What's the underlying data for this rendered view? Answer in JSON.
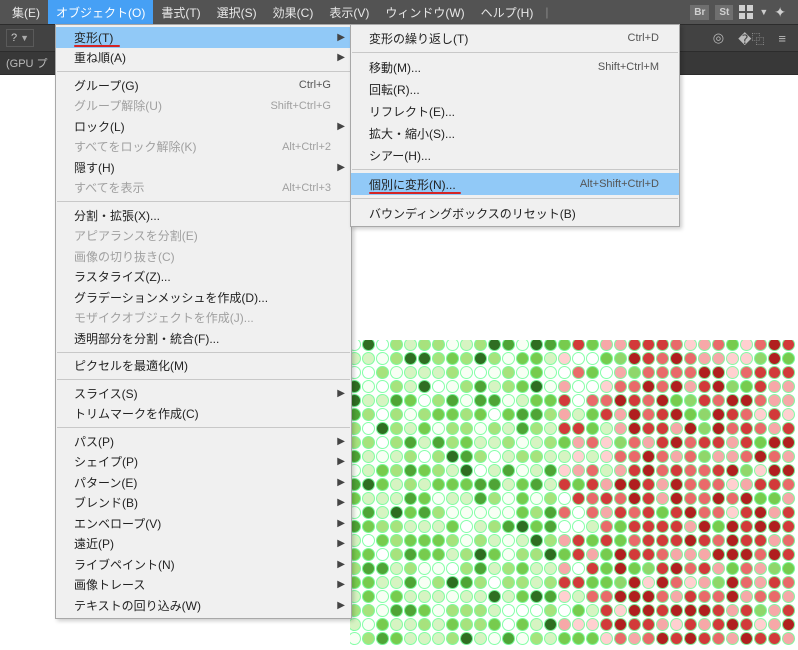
{
  "menubar": {
    "items": [
      "集(E)",
      "オブジェクト(O)",
      "書式(T)",
      "選択(S)",
      "効果(C)",
      "表示(V)",
      "ウィンドウ(W)",
      "ヘルプ(H)"
    ],
    "active_index": 1,
    "badges": [
      "Br",
      "St"
    ]
  },
  "toolbar2": {
    "left_glyph": "?",
    "right_tools": [
      "target-icon",
      "crop-icon",
      "equals-icon"
    ]
  },
  "bar3": {
    "label": "(GPU プ"
  },
  "dropdown1": {
    "groups": [
      [
        {
          "label": "変形(T)",
          "submenu": true,
          "highlight": true,
          "underline": true
        },
        {
          "label": "重ね順(A)",
          "submenu": true
        }
      ],
      [
        {
          "label": "グループ(G)",
          "shortcut": "Ctrl+G"
        },
        {
          "label": "グループ解除(U)",
          "shortcut": "Shift+Ctrl+G",
          "disabled": true
        },
        {
          "label": "ロック(L)",
          "submenu": true
        },
        {
          "label": "すべてをロック解除(K)",
          "shortcut": "Alt+Ctrl+2",
          "disabled": true
        },
        {
          "label": "隠す(H)",
          "submenu": true
        },
        {
          "label": "すべてを表示",
          "shortcut": "Alt+Ctrl+3",
          "disabled": true
        }
      ],
      [
        {
          "label": "分割・拡張(X)..."
        },
        {
          "label": "アピアランスを分割(E)",
          "disabled": true
        },
        {
          "label": "画像の切り抜き(C)",
          "disabled": true
        },
        {
          "label": "ラスタライズ(Z)..."
        },
        {
          "label": "グラデーションメッシュを作成(D)..."
        },
        {
          "label": "モザイクオブジェクトを作成(J)...",
          "disabled": true
        },
        {
          "label": "透明部分を分割・統合(F)..."
        }
      ],
      [
        {
          "label": "ピクセルを最適化(M)"
        }
      ],
      [
        {
          "label": "スライス(S)",
          "submenu": true
        },
        {
          "label": "トリムマークを作成(C)"
        }
      ],
      [
        {
          "label": "パス(P)",
          "submenu": true
        },
        {
          "label": "シェイプ(P)",
          "submenu": true
        },
        {
          "label": "パターン(E)",
          "submenu": true
        },
        {
          "label": "ブレンド(B)",
          "submenu": true
        },
        {
          "label": "エンベロープ(V)",
          "submenu": true
        },
        {
          "label": "遠近(P)",
          "submenu": true
        },
        {
          "label": "ライブペイント(N)",
          "submenu": true
        },
        {
          "label": "画像トレース",
          "submenu": true
        },
        {
          "label": "テキストの回り込み(W)",
          "submenu": true
        }
      ]
    ]
  },
  "dropdown2": {
    "groups": [
      [
        {
          "label": "変形の繰り返し(T)",
          "shortcut": "Ctrl+D"
        }
      ],
      [
        {
          "label": "移動(M)...",
          "shortcut": "Shift+Ctrl+M"
        },
        {
          "label": "回転(R)..."
        },
        {
          "label": "リフレクト(E)..."
        },
        {
          "label": "拡大・縮小(S)..."
        },
        {
          "label": "シアー(H)..."
        }
      ],
      [
        {
          "label": "個別に変形(N)...",
          "shortcut": "Alt+Shift+Ctrl+D",
          "highlight": true,
          "underline": true
        }
      ],
      [
        {
          "label": "バウンディングボックスのリセット(B)"
        }
      ]
    ]
  },
  "chart_data": {
    "type": "heatmap",
    "description": "Grid of colored circles on canvas (approx 32×22 visible), palette ranges green→white→red. Left region predominantly light/medium green, right and lower-right region predominantly red/dark-red with scattered pink and green.",
    "palette": {
      "c0": "#f8fff4",
      "c1": "#d6f4c2",
      "c2": "#a7e27d",
      "c3": "#77cb4e",
      "c4": "#4fa436",
      "c5": "#2f6e22",
      "c6": "#f6a8a8",
      "c7": "#e96a6a",
      "c8": "#d23a3a",
      "c9": "#b01f1f",
      "c10": "#ffd0d0",
      "c11": "#90d66b",
      "c12": "#ffffff"
    },
    "rows": 22,
    "cols": 32
  }
}
